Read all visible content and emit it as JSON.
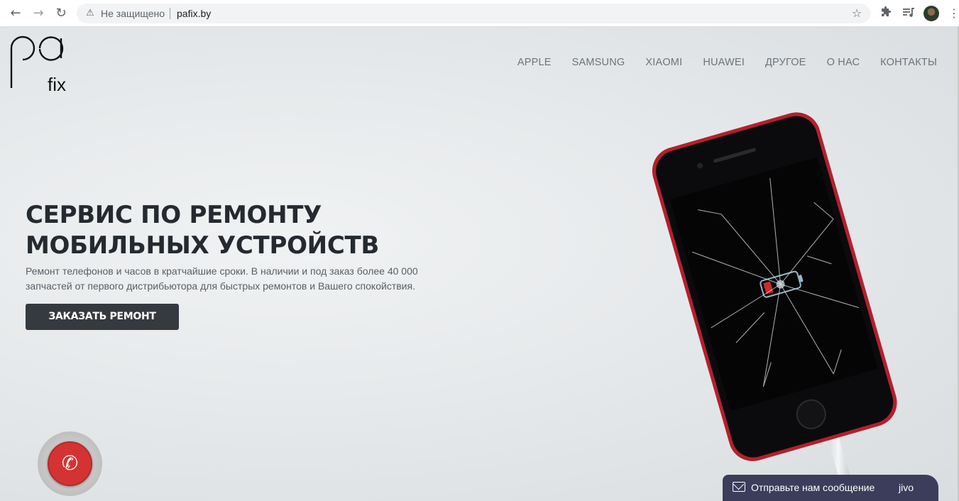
{
  "browser": {
    "back_icon": "arrow-left-icon",
    "forward_icon": "arrow-right-icon",
    "reload_icon": "reload-icon",
    "security_icon": "warning-icon",
    "security_label": "Не защищено",
    "url": "pafix.by",
    "bookmark_icon": "star-icon",
    "extensions_icon": "puzzle-icon",
    "media_icon": "media-queue-icon",
    "menu_icon": "kebab-menu-icon"
  },
  "site": {
    "logo_text": "fix",
    "nav": [
      {
        "label": "APPLE"
      },
      {
        "label": "SAMSUNG"
      },
      {
        "label": "XIAOMI"
      },
      {
        "label": "HUAWEI"
      },
      {
        "label": "ДРУГОЕ"
      },
      {
        "label": "О НАС"
      },
      {
        "label": "КОНТАКТЫ"
      }
    ],
    "hero": {
      "title_line1": "СЕРВИС ПО РЕМОНТУ",
      "title_line2": "МОБИЛЬНЫХ УСТРОЙСТВ",
      "text_line1": "Ремонт телефонов и часов в кратчайшие сроки. В наличии и под заказ более 40 000",
      "text_line2": "запчастей от первого дистрибьютора для быстрых ремонтов и Вашего спокойствия.",
      "cta_label": "ЗАКАЗАТЬ РЕМОНТ"
    },
    "call_icon": "phone-icon",
    "chat": {
      "label": "Отправьте нам сообщение",
      "brand": "jivo"
    }
  },
  "colors": {
    "cta_background": "#343a40",
    "call_button": "#d43333",
    "chat_background": "#3b3d5a",
    "phone_body": "#b3202c"
  }
}
